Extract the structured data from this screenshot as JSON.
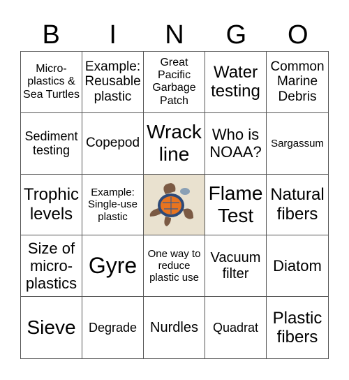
{
  "header": {
    "letters": [
      "B",
      "I",
      "N",
      "G",
      "O"
    ]
  },
  "free_space": {
    "icon": "sea-turtle-image",
    "shell_color": "#e8741f",
    "background": "#e9e1cf"
  },
  "cells": [
    "Micro-plastics & Sea Turtles",
    "Example: Reusable plastic",
    "Great Pacific Garbage Patch",
    "Water testing",
    "Common Marine Debris",
    "Sediment testing",
    "Copepod",
    "Wrack line",
    "Who is NOAA?",
    "Sargassum",
    "Trophic levels",
    "Example: Single-use plastic",
    "",
    "Flame Test",
    "Natural fibers",
    "Size of micro-plastics",
    "Gyre",
    "One way to reduce plastic use",
    "Vacuum filter",
    "Diatom",
    "Sieve",
    "Degrade",
    "Nurdles",
    "Quadrat",
    "Plastic fibers"
  ]
}
